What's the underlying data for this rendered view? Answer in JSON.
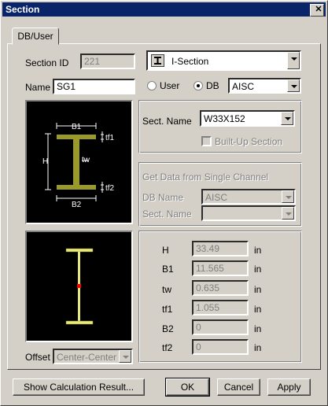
{
  "window": {
    "title": "Section",
    "close_glyph": "✕"
  },
  "tabs": [
    {
      "label": "DB/User"
    }
  ],
  "section_id": {
    "label": "Section ID",
    "value": "221"
  },
  "shape_combo": {
    "value": "I-Section",
    "icon": "i-section-icon"
  },
  "name": {
    "label": "Name",
    "value": "SG1"
  },
  "source": {
    "user_label": "User",
    "db_label": "DB",
    "selected": "DB",
    "db_value": "AISC"
  },
  "dimension_diagram": {
    "b1": "B1",
    "tf1": "tf1",
    "h": "H",
    "tw": "tw",
    "tf2": "tf2",
    "b2": "B2"
  },
  "sect_name": {
    "label": "Sect. Name",
    "value": "W33X152",
    "builtup_label": "Built-Up Section"
  },
  "single_channel": {
    "title": "Get Data from Single Channel",
    "db_name_label": "DB Name",
    "db_name_value": "AISC",
    "sect_name_label": "Sect. Name",
    "sect_name_value": ""
  },
  "dimensions": [
    {
      "label": "H",
      "value": "33.49",
      "unit": "in"
    },
    {
      "label": "B1",
      "value": "11.565",
      "unit": "in"
    },
    {
      "label": "tw",
      "value": "0.635",
      "unit": "in"
    },
    {
      "label": "tf1",
      "value": "1.055",
      "unit": "in"
    },
    {
      "label": "B2",
      "value": "0",
      "unit": "in"
    },
    {
      "label": "tf2",
      "value": "0",
      "unit": "in"
    }
  ],
  "offset": {
    "label": "Offset",
    "value": "Center-Center"
  },
  "buttons": {
    "calc": "Show Calculation Result...",
    "ok": "OK",
    "cancel": "Cancel",
    "apply": "Apply"
  },
  "colors": {
    "title_bar": "#0a246a",
    "face": "#d4d0c8",
    "section_fill": "#9a9a2a",
    "section_preview": "#e8e880",
    "centroid": "#ff0000"
  }
}
